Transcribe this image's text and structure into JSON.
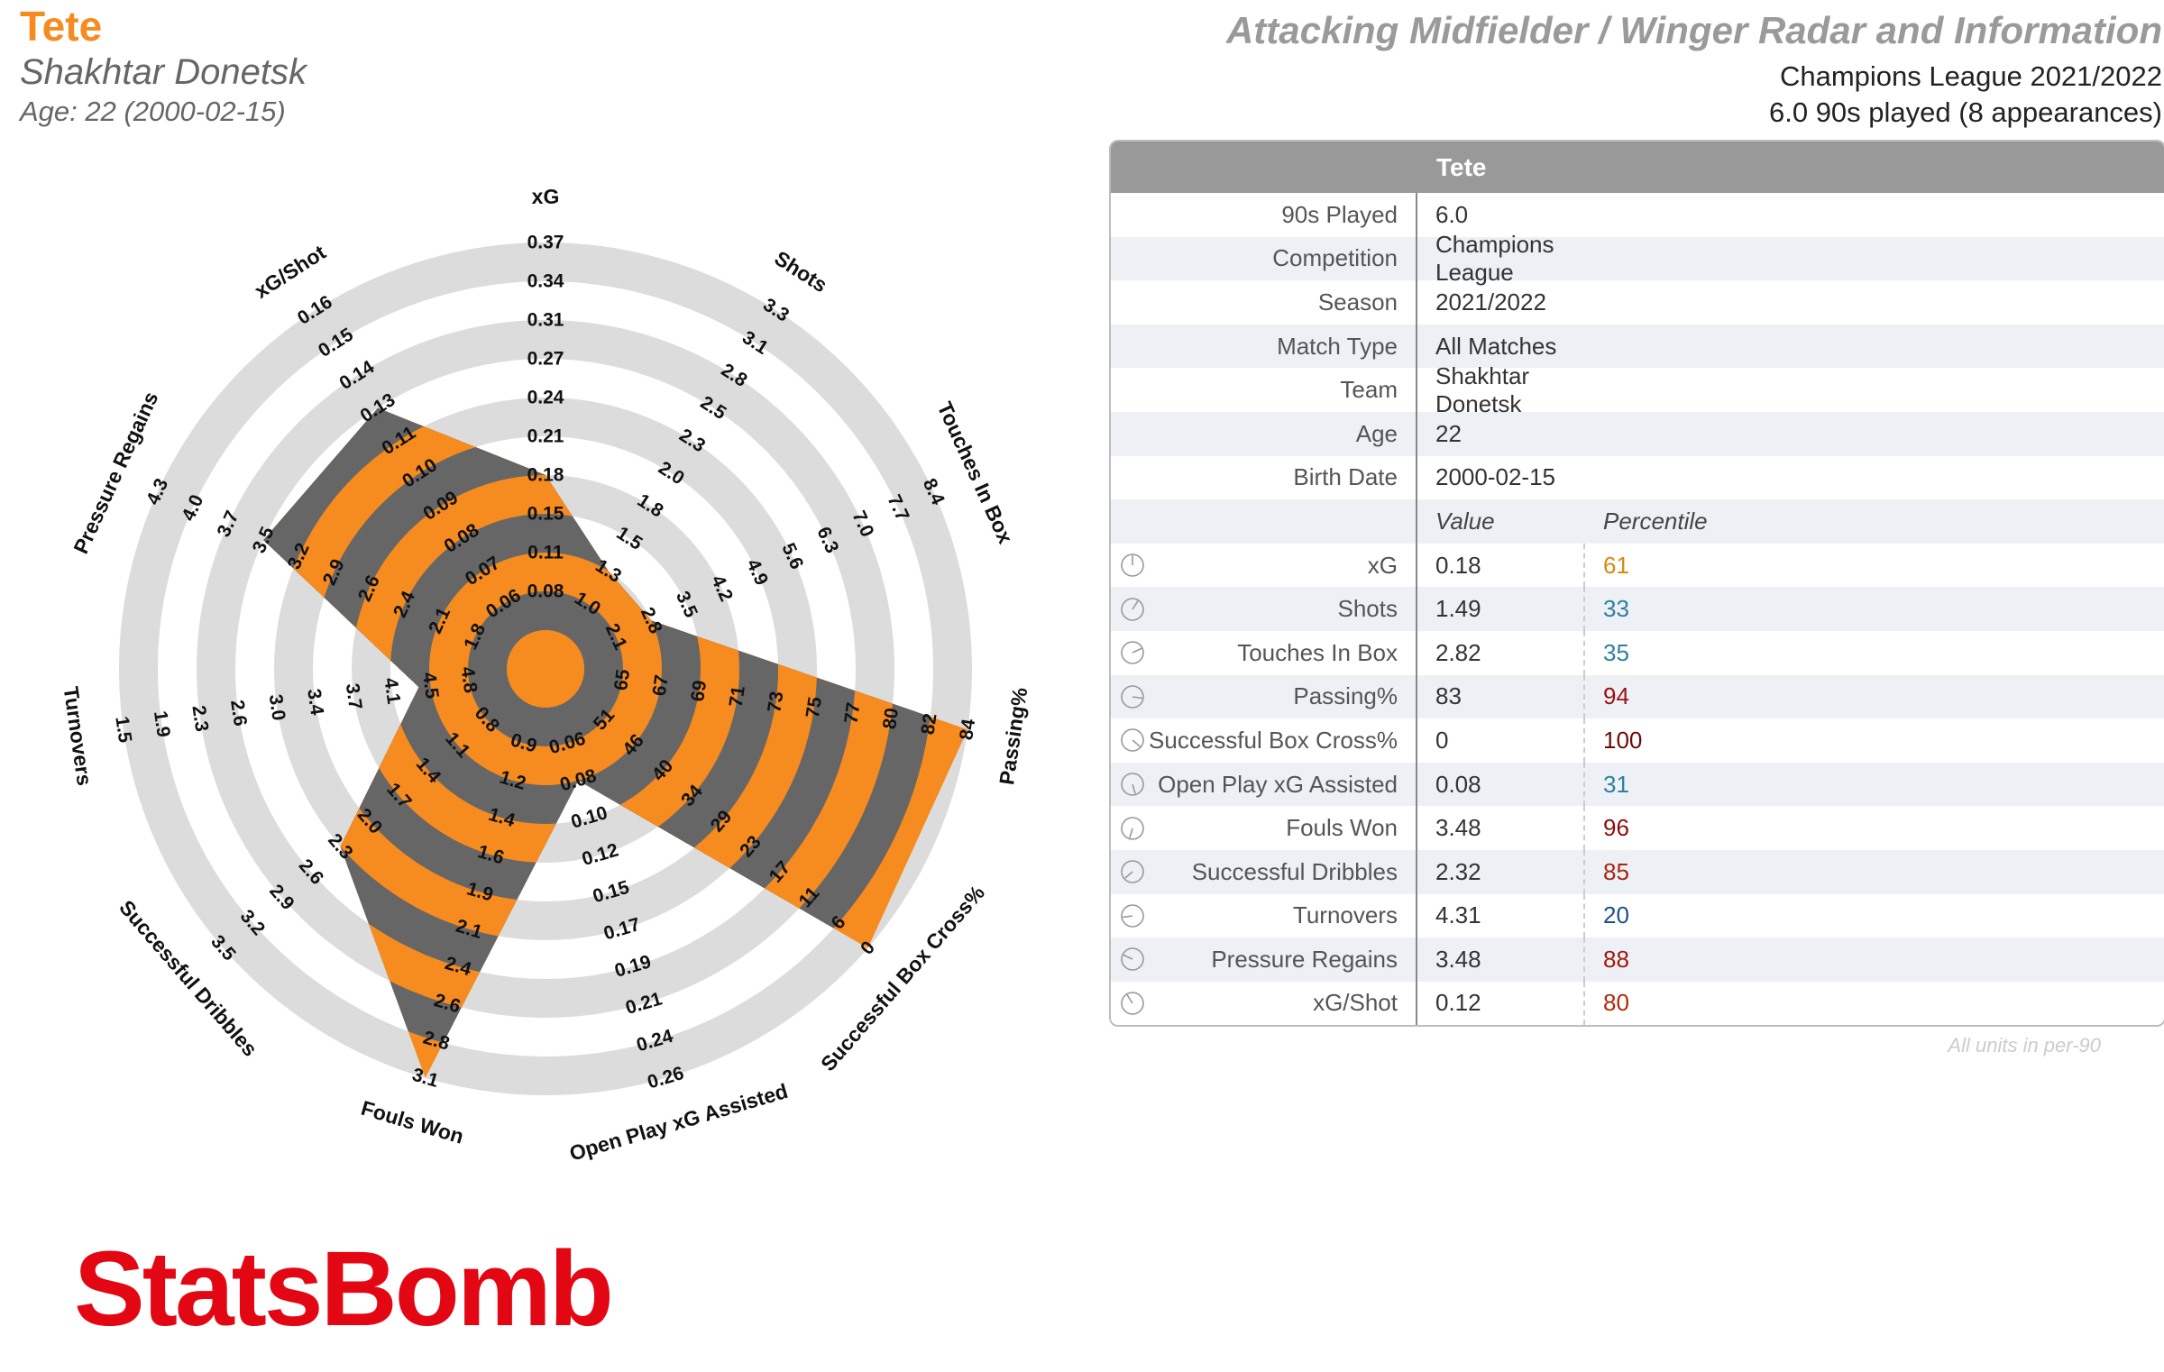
{
  "header": {
    "player_name": "Tete",
    "team": "Shakhtar Donetsk",
    "age_line": "Age: 22 (2000-02-15)",
    "report_title": "Attacking Midfielder / Winger Radar and Information",
    "competition_line": "Champions League 2021/2022",
    "played_line": "6.0 90s played (8 appearances)"
  },
  "colors": {
    "accent": "#f68b1f",
    "band_dark": "#666666",
    "ring_light": "#dcdcdc",
    "logo_red": "#e30613"
  },
  "table": {
    "title": "Tete",
    "info_rows": [
      {
        "label": "90s Played",
        "value": "6.0"
      },
      {
        "label": "Competition",
        "value": "Champions League"
      },
      {
        "label": "Season",
        "value": "2021/2022"
      },
      {
        "label": "Match Type",
        "value": "All Matches"
      },
      {
        "label": "Team",
        "value": "Shakhtar Donetsk"
      },
      {
        "label": "Age",
        "value": "22"
      },
      {
        "label": "Birth Date",
        "value": "2000-02-15"
      }
    ],
    "value_header": "Value",
    "percentile_header": "Percentile",
    "metric_rows": [
      {
        "label": "xG",
        "value": "0.18",
        "percentile": "61",
        "color": "#d98a0f"
      },
      {
        "label": "Shots",
        "value": "1.49",
        "percentile": "33",
        "color": "#2f7f9e"
      },
      {
        "label": "Touches In Box",
        "value": "2.82",
        "percentile": "35",
        "color": "#2f7f9e"
      },
      {
        "label": "Passing%",
        "value": "83",
        "percentile": "94",
        "color": "#9b1010"
      },
      {
        "label": "Successful Box Cross%",
        "value": "0",
        "percentile": "100",
        "color": "#6b0a0a"
      },
      {
        "label": "Open Play xG Assisted",
        "value": "0.08",
        "percentile": "31",
        "color": "#2f7f9e"
      },
      {
        "label": "Fouls Won",
        "value": "3.48",
        "percentile": "96",
        "color": "#8b0e0e"
      },
      {
        "label": "Successful Dribbles",
        "value": "2.32",
        "percentile": "85",
        "color": "#a8260f"
      },
      {
        "label": "Turnovers",
        "value": "4.31",
        "percentile": "20",
        "color": "#1f4f8a"
      },
      {
        "label": "Pressure Regains",
        "value": "3.48",
        "percentile": "88",
        "color": "#a01a10"
      },
      {
        "label": "xG/Shot",
        "value": "0.12",
        "percentile": "80",
        "color": "#b02a0c"
      }
    ],
    "footnote": "All units in per-90"
  },
  "logo": "StatsBomb",
  "chart_data": {
    "type": "radar",
    "title": "Attacking Midfielder / Winger Radar and Information",
    "axes": [
      {
        "name": "xG",
        "value": 0.18,
        "ticks": [
          "0.08",
          "0.11",
          "0.15",
          "0.18",
          "0.21",
          "0.24",
          "0.27",
          "0.31",
          "0.34",
          "0.37"
        ]
      },
      {
        "name": "Shots",
        "value": 1.49,
        "ticks": [
          "1.0",
          "1.3",
          "1.5",
          "1.8",
          "2.0",
          "2.3",
          "2.5",
          "2.8",
          "3.1",
          "3.3"
        ]
      },
      {
        "name": "Touches In Box",
        "value": 2.82,
        "ticks": [
          "2.1",
          "2.8",
          "3.5",
          "4.2",
          "4.9",
          "5.6",
          "6.3",
          "7.0",
          "7.7",
          "8.4"
        ]
      },
      {
        "name": "Passing%",
        "value": 83,
        "ticks": [
          "65",
          "67",
          "69",
          "71",
          "73",
          "75",
          "77",
          "80",
          "82",
          "84"
        ]
      },
      {
        "name": "Successful Box Cross%",
        "value": 0,
        "ticks": [
          "51",
          "46",
          "40",
          "34",
          "29",
          "23",
          "17",
          "11",
          "6",
          "0"
        ]
      },
      {
        "name": "Open Play xG Assisted",
        "value": 0.08,
        "ticks": [
          "0.06",
          "0.08",
          "0.10",
          "0.12",
          "0.15",
          "0.17",
          "0.19",
          "0.21",
          "0.24",
          "0.26"
        ]
      },
      {
        "name": "Fouls Won",
        "value": 3.48,
        "ticks": [
          "0.9",
          "1.2",
          "1.4",
          "1.6",
          "1.9",
          "2.1",
          "2.4",
          "2.6",
          "2.8",
          "3.1"
        ]
      },
      {
        "name": "Successful Dribbles",
        "value": 2.32,
        "ticks": [
          "0.8",
          "1.1",
          "1.4",
          "1.7",
          "2.0",
          "2.3",
          "2.6",
          "2.9",
          "3.2",
          "3.5"
        ]
      },
      {
        "name": "Turnovers",
        "value": 4.31,
        "ticks": [
          "4.8",
          "4.5",
          "4.1",
          "3.7",
          "3.4",
          "3.0",
          "2.6",
          "2.3",
          "1.9",
          "1.5"
        ]
      },
      {
        "name": "Pressure Regains",
        "value": 3.48,
        "ticks": [
          "1.8",
          "2.1",
          "2.4",
          "2.6",
          "2.9",
          "3.2",
          "3.5",
          "3.7",
          "4.0",
          "4.3"
        ]
      },
      {
        "name": "xG/Shot",
        "value": 0.12,
        "ticks": [
          "0.06",
          "0.07",
          "0.08",
          "0.09",
          "0.10",
          "0.11",
          "0.13",
          "0.14",
          "0.15",
          "0.16"
        ]
      }
    ],
    "display_ring_index": [
      5,
      3,
      3,
      11,
      11,
      3,
      11,
      7,
      3.3,
      8,
      8
    ],
    "grid": true,
    "legend": "none"
  }
}
